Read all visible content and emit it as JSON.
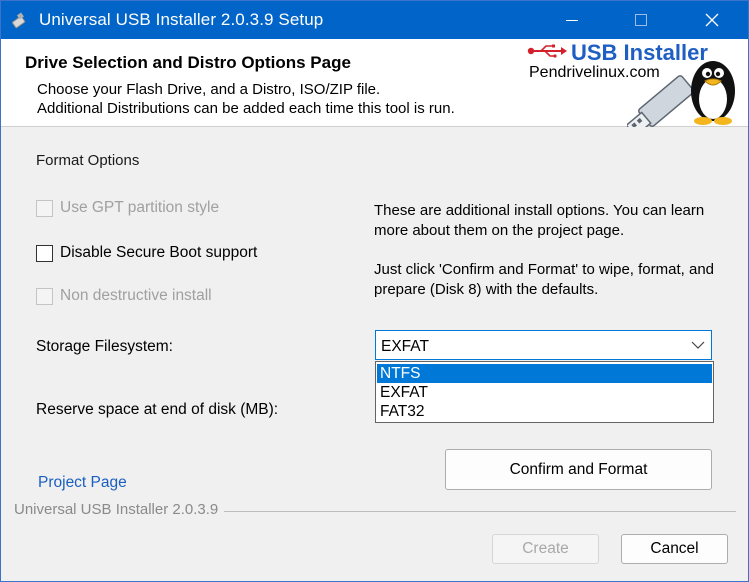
{
  "window": {
    "title": "Universal USB Installer 2.0.3.9 Setup",
    "controls": {
      "minimize": "minimize-icon",
      "maximize": "maximize-icon",
      "close": "close-icon"
    },
    "accent": "#0064c8"
  },
  "header": {
    "title": "Drive Selection and Distro Options Page",
    "line1": "Choose your Flash Drive, and a Distro, ISO/ZIP file.",
    "line2": "Additional Distributions can be added each time this tool is run.",
    "logo": {
      "title": "USB Installer",
      "subtitle": "Pendrivelinux.com"
    }
  },
  "format_options": {
    "heading": "Format Options",
    "options": [
      {
        "label": "Use GPT partition style",
        "checked": false,
        "enabled": false
      },
      {
        "label": "Disable Secure Boot support",
        "checked": false,
        "enabled": true
      },
      {
        "label": "Non destructive install",
        "checked": false,
        "enabled": false
      }
    ]
  },
  "info": {
    "paragraph1": "These are additional install options. You can learn more about them on the project page.",
    "paragraph2": "Just click 'Confirm and Format' to wipe, format, and prepare (Disk 8) with the defaults."
  },
  "storage_filesystem": {
    "label": "Storage Filesystem:",
    "selected": "EXFAT",
    "options": [
      "NTFS",
      "EXFAT",
      "FAT32"
    ],
    "highlighted": "NTFS"
  },
  "reserve_space": {
    "label": "Reserve space at end of disk (MB):"
  },
  "links": {
    "project_page": "Project Page"
  },
  "buttons": {
    "confirm": "Confirm and Format",
    "create": "Create",
    "cancel": "Cancel"
  },
  "footer": {
    "version": "Universal USB Installer 2.0.3.9"
  }
}
